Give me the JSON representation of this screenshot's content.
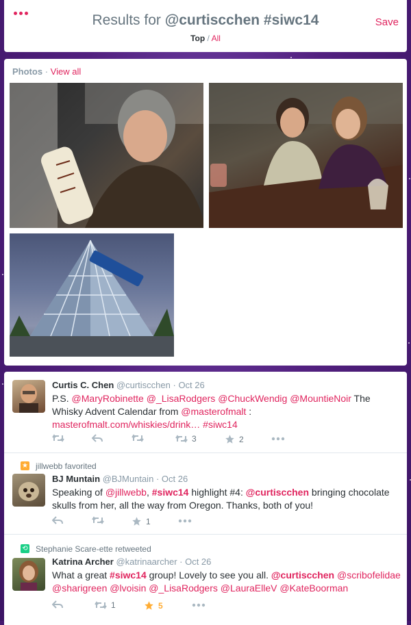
{
  "header": {
    "title_prefix": "Results for",
    "title_query": "@curtiscchen #siwc14",
    "save_label": "Save",
    "scope_top": "Top",
    "scope_sep": "/",
    "scope_all": "All"
  },
  "photos": {
    "label": "Photos",
    "separator": "·",
    "view_all": "View all"
  },
  "colors": {
    "accent": "#e0245e",
    "muted": "#8899a6",
    "fav": "#ffac33",
    "retweet": "#19cf86"
  },
  "tweets": [
    {
      "name": "Curtis C. Chen",
      "handle": "@curtiscchen",
      "time": "· Oct 26",
      "text_parts": {
        "p0": "P.S. ",
        "m1": "@MaryRobinette",
        "m2": "@_LisaRodgers",
        "m3": "@ChuckWendig",
        "m4": "@MountieNoir",
        "p1": " The Whisky Advent Calendar from ",
        "m5": "@masterofmalt",
        "p2": " : ",
        "url": "masterofmalt.com/whiskies/drink…",
        "tag": "#siwc14"
      },
      "retweets": "3",
      "favorites": "2"
    },
    {
      "context": "jillwebb favorited",
      "name": "BJ Muntain",
      "handle": "@BJMuntain",
      "time": "· Oct 26",
      "text_parts": {
        "p0": "Speaking of ",
        "m1": "@jillwebb",
        "p1": ", ",
        "tag": "#siwc14",
        "p2": " highlight #4: ",
        "m2": "@curtiscchen",
        "p3": " bringing chocolate skulls from her, all the way from Oregon. Thanks, both of you!"
      },
      "favorites": "1"
    },
    {
      "context": "Stephanie Scare-ette retweeted",
      "name": "Katrina Archer",
      "handle": "@katrinaarcher",
      "time": "· Oct 26",
      "text_parts": {
        "p0": "What a great ",
        "tag": "#siwc14",
        "p1": " group! Lovely to see you all. ",
        "m1": "@curtiscchen",
        "m2": "@scribofelidae",
        "m3": "@sharigreen",
        "m4": "@lvoisin",
        "m5": "@_LisaRodgers",
        "m6": "@LauraElleV",
        "m7": "@KateBoorman"
      },
      "retweets": "1",
      "favorites": "5"
    }
  ]
}
